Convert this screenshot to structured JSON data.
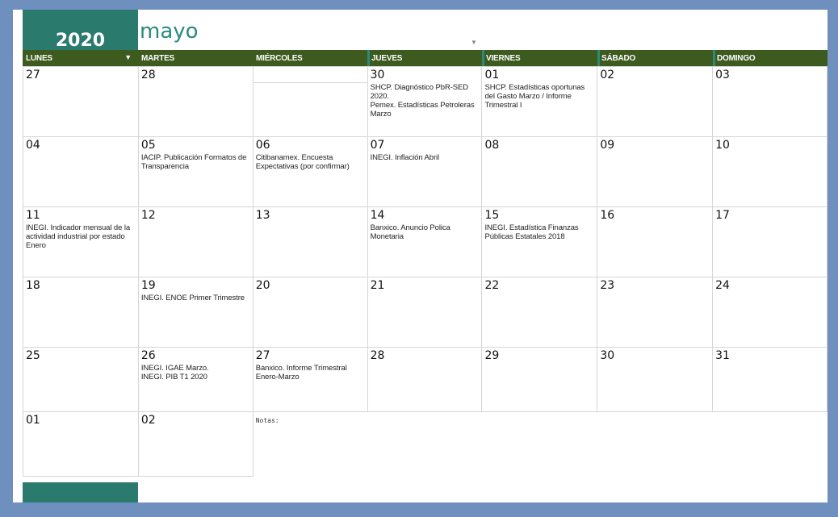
{
  "year": "2020",
  "month": "mayo",
  "weekdays": [
    "LUNES",
    "MARTES",
    "MIÉRCOLES",
    "JUEVES",
    "VIERNES",
    "SÁBADO",
    "DOMINGO"
  ],
  "weeks": [
    [
      {
        "day": "27",
        "event": ""
      },
      {
        "day": "28",
        "event": ""
      },
      {
        "day": "",
        "event": ""
      },
      {
        "day": "30",
        "event": "SHCP. Diagnóstico PbR-SED 2020.\nPemex. Estadísticas Petroleras Marzo"
      },
      {
        "day": "01",
        "event": "SHCP. Estadísticas oportunas del Gasto Marzo / Informe Trimestral I"
      },
      {
        "day": "02",
        "event": ""
      },
      {
        "day": "03",
        "event": ""
      }
    ],
    [
      {
        "day": "04",
        "event": ""
      },
      {
        "day": "05",
        "event": "IACIP. Publicación Formatos de Transparencia"
      },
      {
        "day": "06",
        "event": "Citibanamex. Encuesta Expectativas (por confirmar)"
      },
      {
        "day": "07",
        "event": "INEGI. Inflación Abril"
      },
      {
        "day": "08",
        "event": ""
      },
      {
        "day": "09",
        "event": ""
      },
      {
        "day": "10",
        "event": ""
      }
    ],
    [
      {
        "day": "11",
        "event": "INEGI. Indicador mensual de la actividad industrial por estado Enero"
      },
      {
        "day": "12",
        "event": ""
      },
      {
        "day": "13",
        "event": ""
      },
      {
        "day": "14",
        "event": "Banxico. Anuncio Polica Monetaria"
      },
      {
        "day": "15",
        "event": "INEGI. Estadística Finanzas Públicas Estatales 2018"
      },
      {
        "day": "16",
        "event": ""
      },
      {
        "day": "17",
        "event": ""
      }
    ],
    [
      {
        "day": "18",
        "event": ""
      },
      {
        "day": "19",
        "event": "INEGI. ENOE Primer Trimestre"
      },
      {
        "day": "20",
        "event": ""
      },
      {
        "day": "21",
        "event": ""
      },
      {
        "day": "22",
        "event": ""
      },
      {
        "day": "23",
        "event": ""
      },
      {
        "day": "24",
        "event": ""
      }
    ],
    [
      {
        "day": "25",
        "event": ""
      },
      {
        "day": "26",
        "event": "INEGI. IGAE Marzo.\nINEGI. PIB T1 2020"
      },
      {
        "day": "27",
        "event": "Banxico. Informe Trimestral Enero-Marzo"
      },
      {
        "day": "28",
        "event": ""
      },
      {
        "day": "29",
        "event": ""
      },
      {
        "day": "30",
        "event": ""
      },
      {
        "day": "31",
        "event": ""
      }
    ],
    [
      {
        "day": "01",
        "event": ""
      },
      {
        "day": "02",
        "event": ""
      }
    ]
  ],
  "notes_label": "Notas:",
  "colors": {
    "header_bg": "#3d5a1f",
    "accent": "#2b7a6e",
    "title": "#2b8a7e",
    "background": "#6f8fbe"
  }
}
